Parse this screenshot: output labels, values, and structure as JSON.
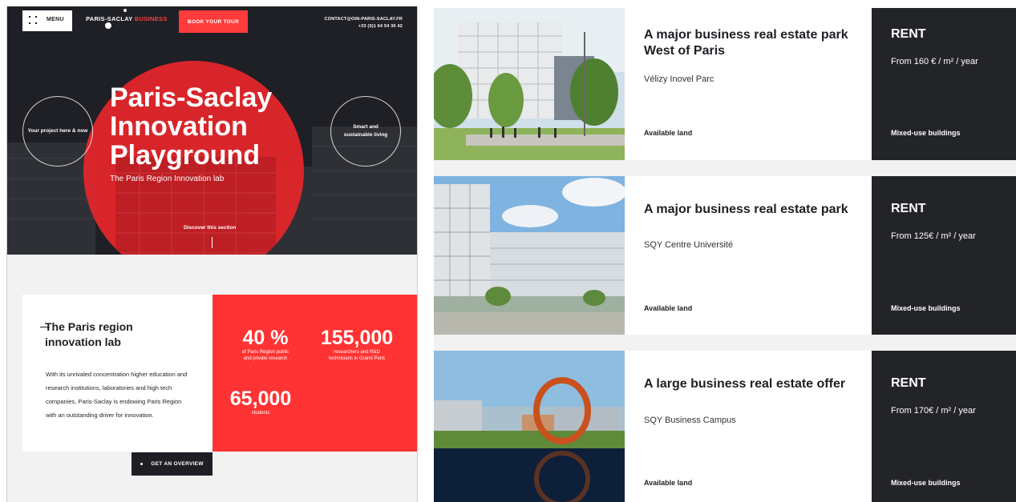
{
  "left": {
    "header": {
      "menu_label": "MENU",
      "brand_main": "PARIS-SACLAY",
      "brand_accent": "BUSINESS",
      "tour_button": "BOOK YOUR TOUR",
      "contact_email": "CONTACT@OIN-PARIS-SACLAY.FR",
      "contact_phone": "+33 (0)1 64 54 36 42"
    },
    "hero": {
      "title_line1": "Paris-Saclay",
      "title_line2": "Innovation",
      "title_line3": "Playground",
      "subtitle": "The Paris Region Innovation lab",
      "ring_left": "Your project here & now",
      "ring_right_line1": "Smart and",
      "ring_right_line2": "sustainable living",
      "discover": "Discover this section"
    },
    "info": {
      "title": "The Paris region innovation lab",
      "body": "With its unrivaled concentration higher education and research institutions, laboratories and high tech companies, Paris-Saclay is endowing Paris Region with an outstanding driver for innovation."
    },
    "stats": [
      {
        "value": "40 %",
        "label_line1": "of Paris Region public",
        "label_line2": "and private research"
      },
      {
        "value": "155,000",
        "label_line1": "researchers and R&D",
        "label_line2": "technicians in Grand Paris"
      },
      {
        "value": "65,000",
        "label_line1": "students",
        "label_line2": ""
      }
    ],
    "overview_button": "GET AN OVERVIEW"
  },
  "listings": [
    {
      "title": "A major business real estate park West of Paris",
      "location": "Vélizy Inovel Parc",
      "availability": "Available land",
      "offer": "RENT",
      "price": "From 160 € / m² / year",
      "building_type": "Mixed-use buildings"
    },
    {
      "title": "A major business real estate park",
      "location": "SQY Centre Université",
      "availability": "Available land",
      "offer": "RENT",
      "price": "From 125€ / m² / year",
      "building_type": "Mixed-use buildings"
    },
    {
      "title": "A large business real estate offer",
      "location": "SQY Business Campus",
      "availability": "Available land",
      "offer": "RENT",
      "price": "From 170€ / m² / year",
      "building_type": "Mixed-use buildings"
    }
  ],
  "colors": {
    "accent_red": "#ff3333",
    "dark": "#232428",
    "light_bg": "#f2f2f2"
  }
}
